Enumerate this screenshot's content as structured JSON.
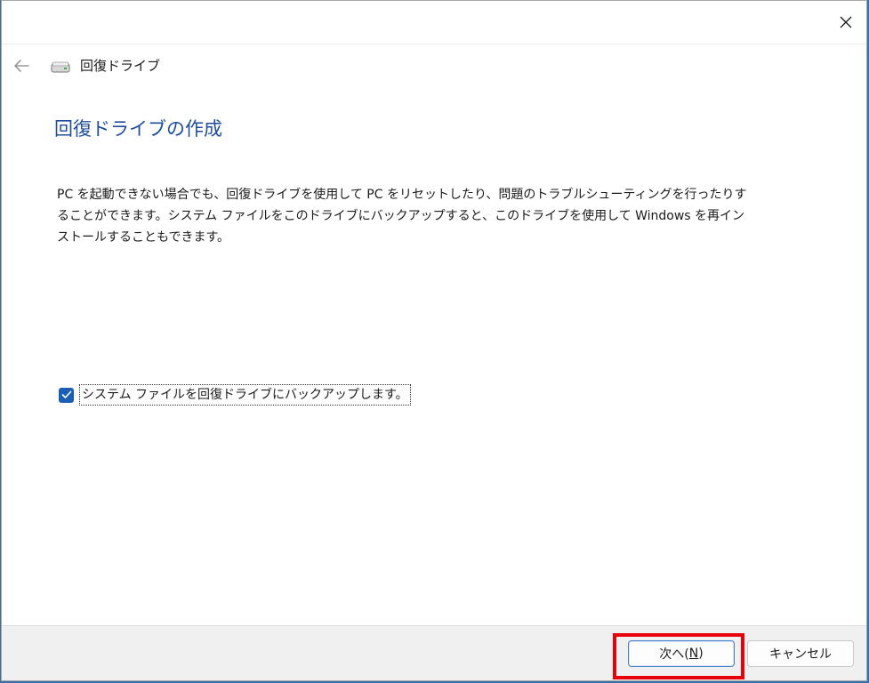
{
  "window": {
    "close_icon": "close-icon"
  },
  "nav": {
    "back_icon": "back-arrow-icon",
    "drive_icon": "recovery-drive-icon",
    "breadcrumb": "回復ドライブ"
  },
  "main": {
    "title": "回復ドライブの作成",
    "description": "PC を起動できない場合でも、回復ドライブを使用して PC をリセットしたり、問題のトラブルシューティングを行ったりすることができます。システム ファイルをこのドライブにバックアップすると、このドライブを使用して Windows を再インストールすることもできます。",
    "backup_checkbox": {
      "label": "システム ファイルを回復ドライブにバックアップします。",
      "checked": true
    }
  },
  "footer": {
    "next_label_prefix": "次へ(",
    "next_label_key": "N",
    "next_label_suffix": ")",
    "cancel_label": "キャンセル"
  },
  "colors": {
    "title": "#1e4e9c",
    "checkbox": "#1a5fb4",
    "highlight": "#e8000b"
  }
}
